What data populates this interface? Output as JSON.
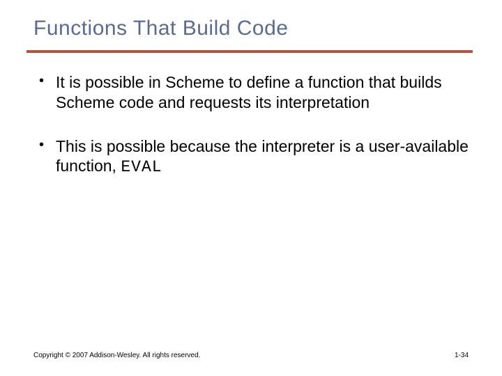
{
  "title": "Functions That Build Code",
  "bullets": [
    {
      "text": "It is possible in Scheme to define a function that builds Scheme code and requests its interpretation"
    },
    {
      "text_prefix": "This is possible because the interpreter is a user-available function, ",
      "code": "EVAL"
    }
  ],
  "footer": {
    "copyright": "Copyright © 2007 Addison-Wesley. All rights reserved.",
    "page": "1-34"
  }
}
